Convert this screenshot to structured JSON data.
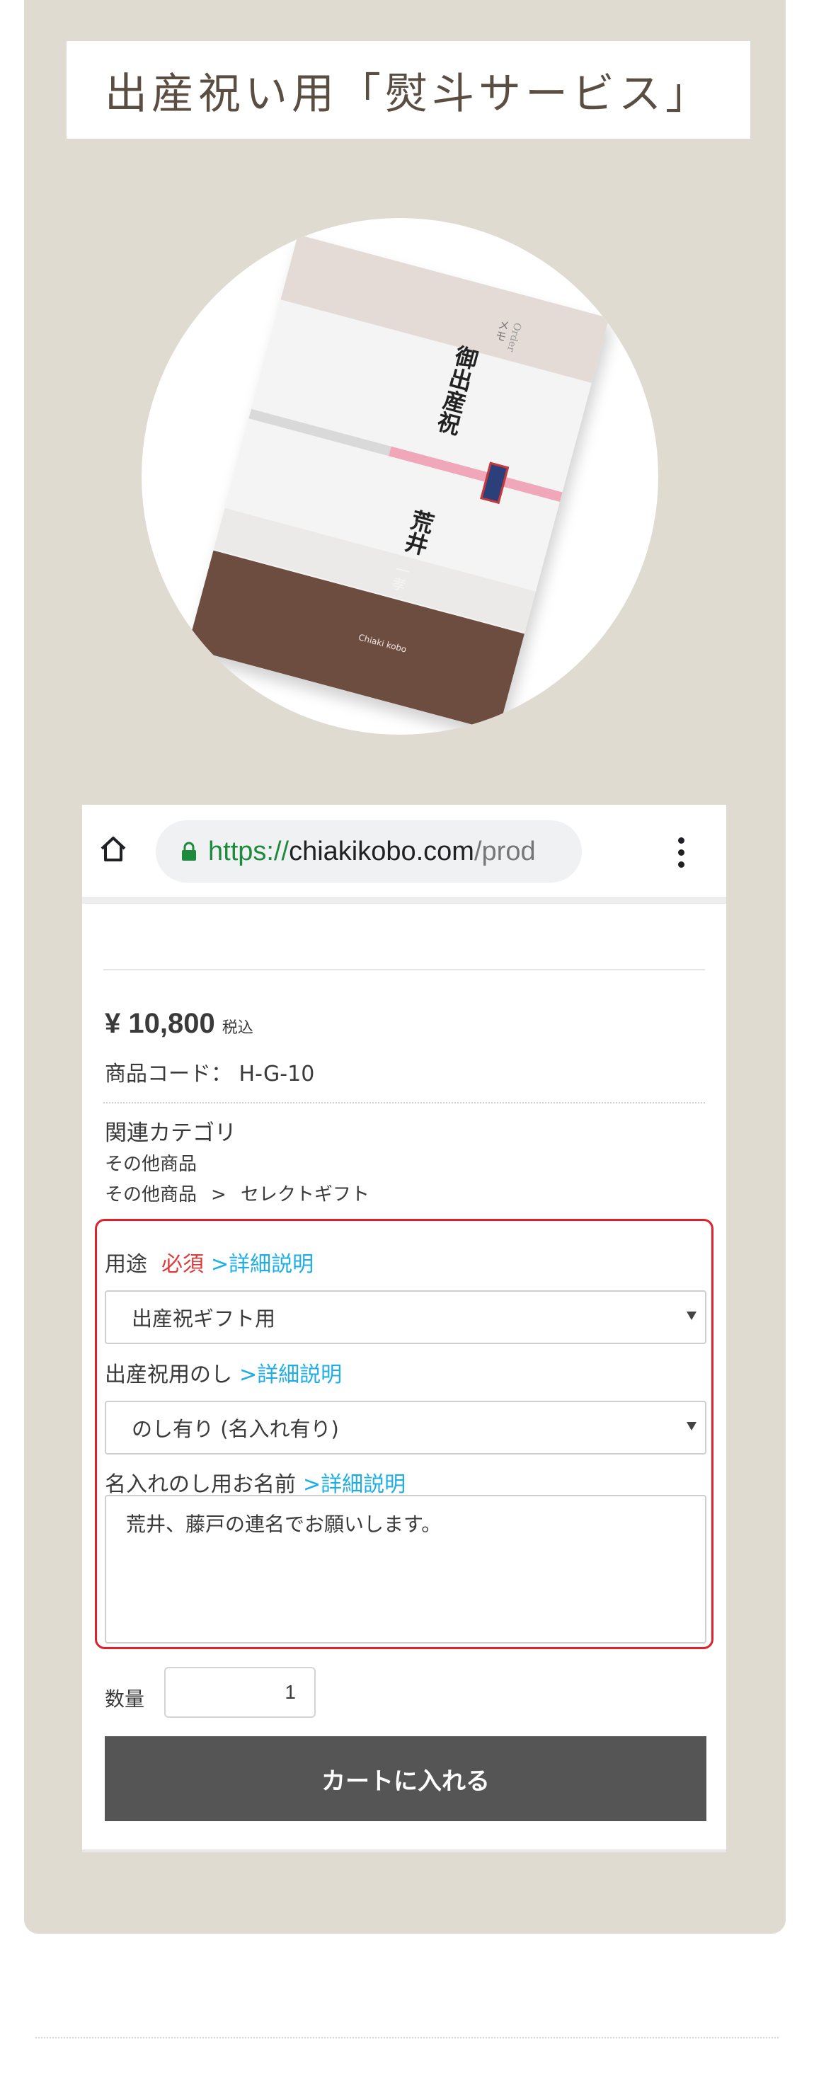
{
  "banner": {
    "title": "出産祝い用「熨斗サービス」"
  },
  "card": {
    "small_text": "メモ",
    "small_text2": "Order",
    "main": "御出産祝",
    "name": "荒井",
    "sub": "一孝",
    "brand": "Chiaki kobo"
  },
  "browser": {
    "url_scheme": "https://",
    "url_host": "chiakikobo.com",
    "url_path": "/prod",
    "icons": [
      "home-icon",
      "lock-icon",
      "more-vert-icon"
    ],
    "scheme_color": "#1e8a3c"
  },
  "product": {
    "price": "¥ 10,800",
    "tax_label": "税込",
    "code_label": "商品コード：",
    "code_value": "H-G-10",
    "category_title": "関連カテゴリ",
    "category_1": "その他商品",
    "category_2_parent": "その他商品",
    "category_2_sep": ">",
    "category_2_child": "セレクトギフト"
  },
  "form": {
    "use_label": "用途",
    "use_required": "必須",
    "use_link": ">詳細説明",
    "use_value": "出産祝ギフト用",
    "noshi_label": "出産祝用のし",
    "noshi_link": ">詳細説明",
    "noshi_value": "のし有り (名入れ有り)",
    "name_label": "名入れのし用お名前",
    "name_link": ">詳細説明",
    "name_value": "荒井、藤戸の連名でお願いします。",
    "qty_label": "数量",
    "qty_value": "1",
    "cart_button": "カートに入れる",
    "highlight_color": "#e0202c",
    "link_color": "#1eaee6"
  }
}
